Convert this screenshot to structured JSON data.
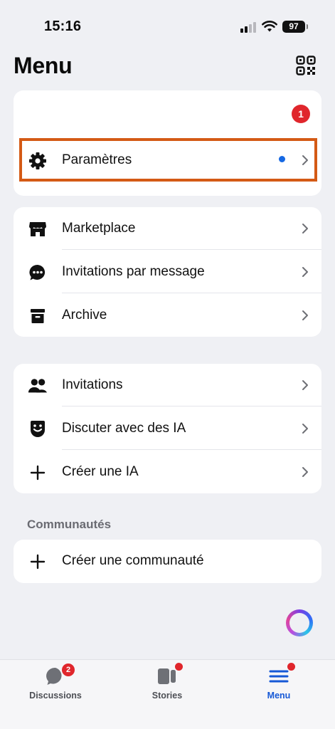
{
  "status_bar": {
    "time": "15:16",
    "battery": "97"
  },
  "header": {
    "title": "Menu"
  },
  "notification_count": "1",
  "settings": {
    "label": "Paramètres"
  },
  "group1": [
    {
      "label": "Marketplace",
      "icon": "storefront-icon"
    },
    {
      "label": "Invitations par message",
      "icon": "chat-bubble-icon"
    },
    {
      "label": "Archive",
      "icon": "archive-box-icon"
    }
  ],
  "group2": [
    {
      "label": "Invitations",
      "icon": "people-icon"
    },
    {
      "label": "Discuter avec des IA",
      "icon": "ai-face-icon"
    },
    {
      "label": "Créer une IA",
      "icon": "plus-icon"
    }
  ],
  "communities": {
    "section_label": "Communautés",
    "create_label": "Créer une communauté"
  },
  "tab_bar": {
    "tabs": [
      {
        "label": "Discussions",
        "badge": "2"
      },
      {
        "label": "Stories"
      },
      {
        "label": "Menu"
      }
    ]
  },
  "colors": {
    "accent": "#1558d6",
    "badge": "#e0262c",
    "highlight": "#d45a15"
  }
}
